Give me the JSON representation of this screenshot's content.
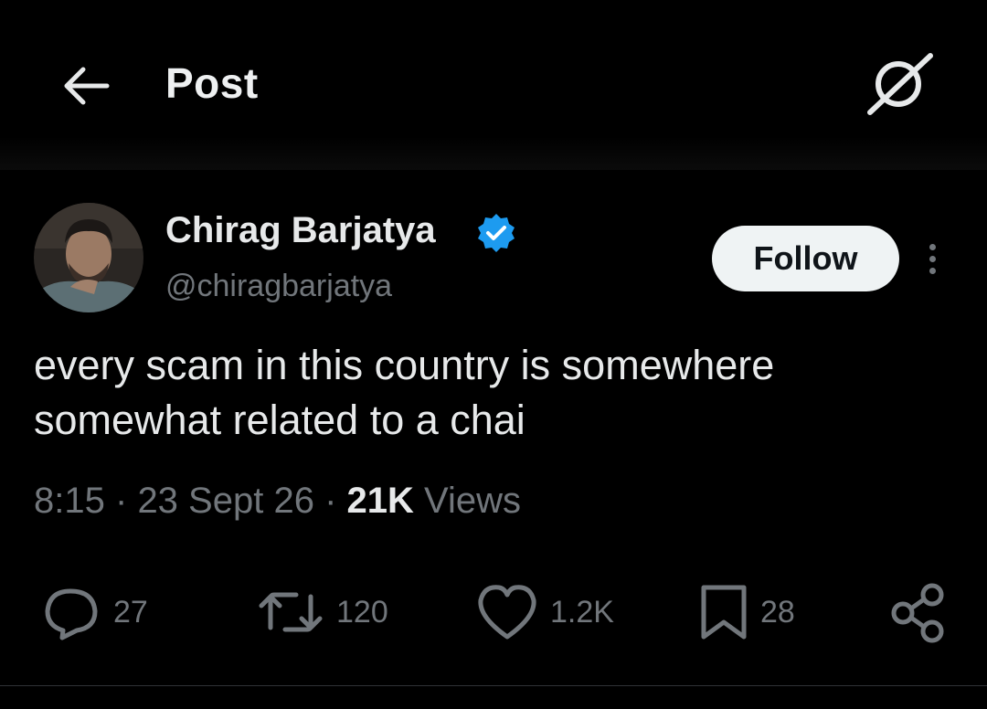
{
  "header": {
    "title": "Post",
    "back_icon": "arrow-left-icon",
    "grok_icon": "grok-icon"
  },
  "post": {
    "author": {
      "name": "Chirag Barjatya",
      "handle": "@chiragbarjatya",
      "verified": true,
      "verified_color": "#1d9bf0"
    },
    "follow_label": "Follow",
    "text_lines": [
      "every scam in this country is somewhere",
      "somewhat related to a chai"
    ],
    "time": "8:15",
    "date": "23 Sept 26",
    "views_count": "21K",
    "views_label": "Views",
    "separator": "·"
  },
  "actions": {
    "replies": "27",
    "reposts": "120",
    "likes": "1.2K",
    "bookmarks": "28"
  },
  "colors": {
    "background": "#000000",
    "text_primary": "#e7e9ea",
    "text_secondary": "#71767b",
    "follow_bg": "#eff3f4"
  }
}
